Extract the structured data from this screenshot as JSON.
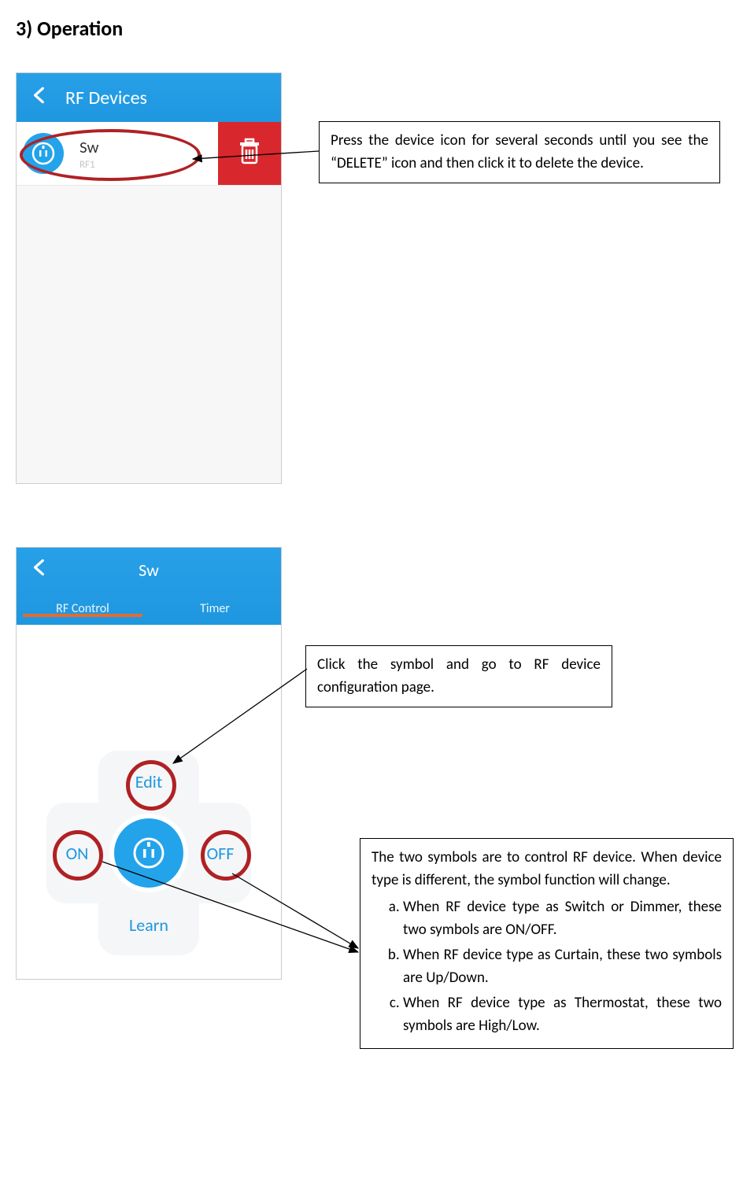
{
  "heading": "3)  Operation",
  "phone1": {
    "title": "RF Devices",
    "device_name": "Sw",
    "device_sub": "RF1"
  },
  "callout1": "Press the device icon for several seconds until you see the “DELETE” icon and then click it to delete the device.",
  "phone2": {
    "title": "Sw",
    "tab1": "RF Control",
    "tab2": "Timer",
    "btn_edit": "Edit",
    "btn_on": "ON",
    "btn_off": "OFF",
    "btn_learn": "Learn"
  },
  "callout2": "Click the symbol and go to RF device configuration page.",
  "callout3": {
    "intro": "The two symbols are to control RF device. When device type is different, the symbol function will change.",
    "a": "When RF device type as Switch or Dimmer, these two symbols are ON/OFF.",
    "b": "When RF device type as Curtain, these two symbols are Up/Down.",
    "c": "When RF device type as Thermostat, these two symbols are High/Low."
  }
}
